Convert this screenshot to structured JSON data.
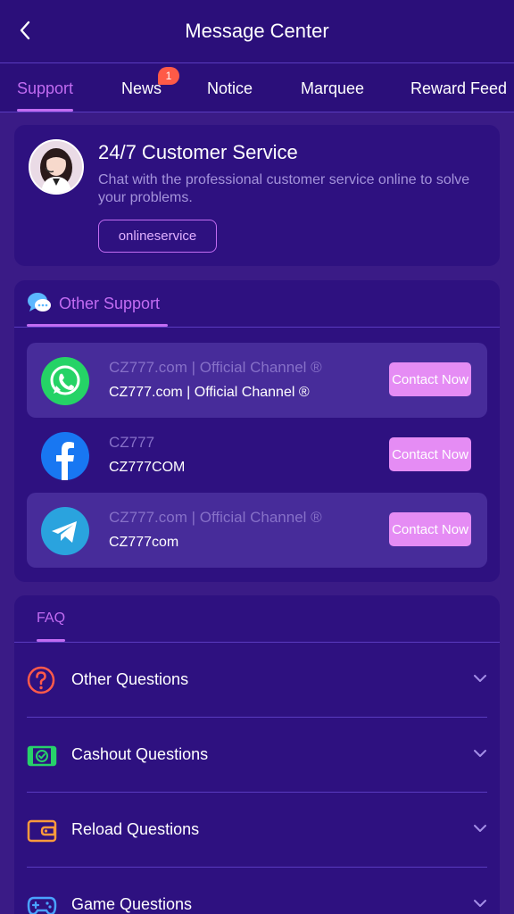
{
  "header": {
    "title": "Message Center",
    "back_icon": "chevron-left-icon"
  },
  "tabs": [
    {
      "label": "Support",
      "active": true
    },
    {
      "label": "News",
      "badge": "1"
    },
    {
      "label": "Notice"
    },
    {
      "label": "Marquee"
    },
    {
      "label": "Reward Feed"
    }
  ],
  "customer_service": {
    "title": "24/7 Customer Service",
    "description": "Chat with the professional customer service online to solve your problems.",
    "button_label": "onlineservice"
  },
  "other_support": {
    "heading": "Other Support",
    "channels": [
      {
        "icon": "whatsapp-icon",
        "name": "CZ777.com | Official Channel ®",
        "handle": "CZ777.com | Official Channel ®",
        "button": "Contact Now"
      },
      {
        "icon": "facebook-icon",
        "name": "CZ777",
        "handle": "CZ777COM",
        "button": "Contact Now"
      },
      {
        "icon": "telegram-icon",
        "name": "CZ777.com | Official Channel ®",
        "handle": "CZ777com",
        "button": "Contact Now"
      }
    ]
  },
  "faq": {
    "heading": "FAQ",
    "items": [
      {
        "icon": "question-icon",
        "label": "Other Questions"
      },
      {
        "icon": "cash-icon",
        "label": "Cashout Questions"
      },
      {
        "icon": "wallet-icon",
        "label": "Reload Questions"
      },
      {
        "icon": "gamepad-icon",
        "label": "Game Questions"
      }
    ]
  },
  "colors": {
    "background": "#3a1b86",
    "header": "#2b0f7a",
    "card": "#2e1180",
    "accent": "#c26cf2",
    "button": "#e58cf4",
    "badge": "#ff5a47"
  }
}
